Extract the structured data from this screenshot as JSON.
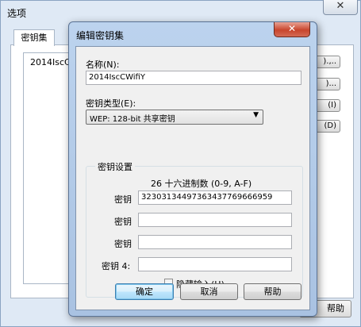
{
  "outer": {
    "title": "选项",
    "close_glyph": "✕",
    "tab_label": "密钥集",
    "list_item": "2014IscCW",
    "side_buttons": [
      ").,..",
      ")...",
      "(I)",
      "(D)"
    ],
    "bottom_button": "帮助"
  },
  "dialog": {
    "title": "编辑密钥集",
    "close_glyph": "✕",
    "name_label": "名称(N):",
    "name_value": "2014IscCWifiY",
    "key_type_label": "密钥类型(E):",
    "key_type_value": "WEP: 128-bit 共享密钥",
    "key_settings_legend": "密钥设置",
    "hex_hint": "26 十六进制数 (0-9, A-F)",
    "keys": [
      {
        "label": "密钥",
        "value": "32303134497363437769666959"
      },
      {
        "label": "密钥",
        "value": ""
      },
      {
        "label": "密钥",
        "value": ""
      },
      {
        "label": "密钥 4:",
        "value": ""
      }
    ],
    "hide_input_label": "隐藏输入(H)",
    "ok_label": "确定",
    "cancel_label": "取消",
    "help_label": "帮助"
  }
}
